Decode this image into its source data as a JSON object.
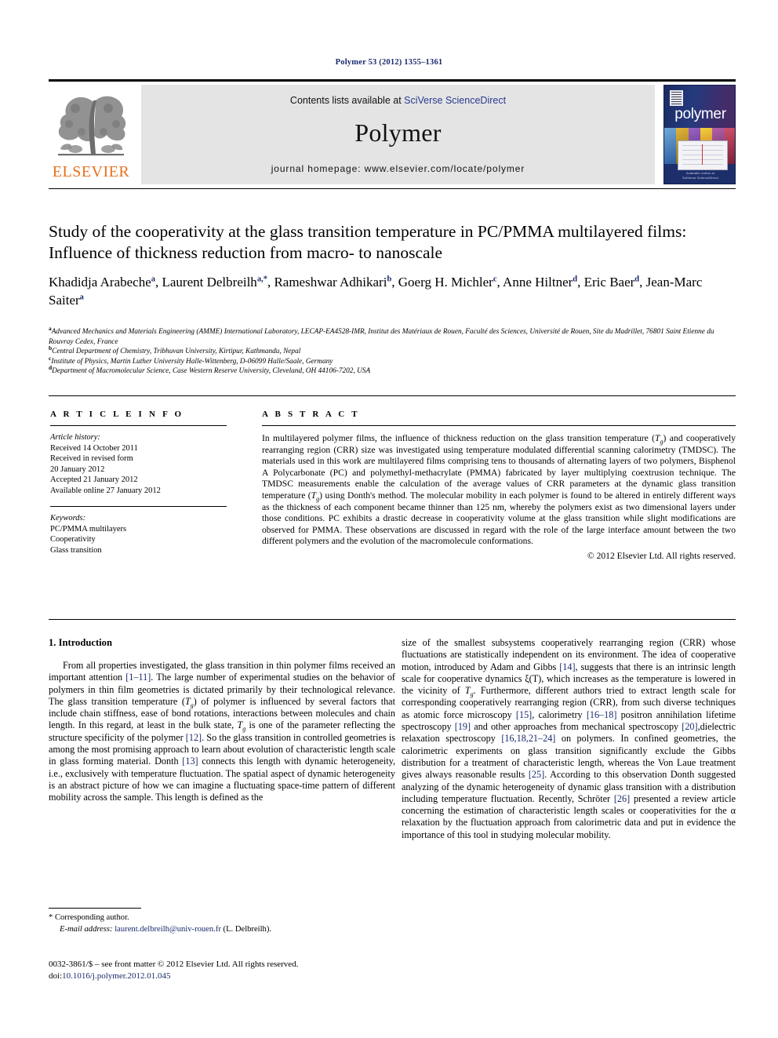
{
  "running_head": "Polymer 53 (2012) 1355–1361",
  "masthead": {
    "publisher_name": "ELSEVIER",
    "contents_prefix": "Contents lists available at ",
    "contents_link": "SciVerse ScienceDirect",
    "journal_title": "Polymer",
    "homepage": "journal homepage: www.elsevier.com/locate/polymer",
    "cover_word": "polymer",
    "cover_footer": "Available online at\nSciVerse ScienceDirect"
  },
  "article": {
    "title": "Study of the cooperativity at the glass transition temperature in PC/PMMA multilayered films: Influence of thickness reduction from macro- to nanoscale",
    "authors_line_1": "Khadidja Arabeche a, Laurent Delbreilh a,*, Rameshwar Adhikari b, Goerg H. Michler c, Anne Hiltner d,",
    "authors_line_2": "Eric Baer d, Jean-Marc Saiter a",
    "authors": [
      {
        "name": "Khadidja Arabeche",
        "sup": "a",
        "sep": ","
      },
      {
        "name": "Laurent Delbreilh",
        "sup": "a,*",
        "sep": ","
      },
      {
        "name": "Rameshwar Adhikari",
        "sup": "b",
        "sep": ","
      },
      {
        "name": "Goerg H. Michler",
        "sup": "c",
        "sep": ","
      },
      {
        "name": "Anne Hiltner",
        "sup": "d",
        "sep": ","
      },
      {
        "name": "Eric Baer",
        "sup": "d",
        "sep": ","
      },
      {
        "name": "Jean-Marc Saiter",
        "sup": "a",
        "sep": ""
      }
    ],
    "affiliations": [
      {
        "label": "a",
        "text": "Advanced Mechanics and Materials Engineering (AMME) International Laboratory, LECAP-EA4528-IMR, Institut des Matériaux de Rouen, Faculté des Sciences, Université de Rouen, Site du Madrillet, 76801 Saint Etienne du Rouvray Cedex, France"
      },
      {
        "label": "b",
        "text": "Central Department of Chemistry, Tribhuvan University, Kirtipur, Kathmandu, Nepal"
      },
      {
        "label": "c",
        "text": "Institute of Physics, Martin Luther University Halle-Wittenberg, D-06099 Halle/Saale, Germany"
      },
      {
        "label": "d",
        "text": "Department of Macromolecular Science, Case Western Reserve University, Cleveland, OH 44106-7202, USA"
      }
    ]
  },
  "article_info": {
    "heading": "A R T I C L E   I N F O",
    "history_label": "Article history:",
    "history": [
      "Received 14 October 2011",
      "Received in revised form",
      "20 January 2012",
      "Accepted 21 January 2012",
      "Available online 27 January 2012"
    ],
    "keywords_label": "Keywords:",
    "keywords": [
      "PC/PMMA multilayers",
      "Cooperativity",
      "Glass transition"
    ]
  },
  "abstract": {
    "heading": "A B S T R A C T",
    "text": "In multilayered polymer films, the influence of thickness reduction on the glass transition temperature (Tg) and cooperatively rearranging region (CRR) size was investigated using temperature modulated differential scanning calorimetry (TMDSC). The materials used in this work are multilayered films comprising tens to thousands of alternating layers of two polymers, Bisphenol A Polycarbonate (PC) and polymethyl-methacrylate (PMMA) fabricated by layer multiplying coextrusion technique. The TMDSC measurements enable the calculation of the average values of CRR parameters at the dynamic glass transition temperature (Tg) using Donth's method. The molecular mobility in each polymer is found to be altered in entirely different ways as the thickness of each component became thinner than 125 nm, whereby the polymers exist as two dimensional layers under those conditions. PC exhibits a drastic decrease in cooperativity volume at the glass transition while slight modifications are observed for PMMA. These observations are discussed in regard with the role of the large interface amount between the two different polymers and the evolution of the macromolecule conformations.",
    "copyright": "© 2012 Elsevier Ltd. All rights reserved."
  },
  "body": {
    "section_number_title": "1. Introduction",
    "left_paragraph": "From all properties investigated, the glass transition in thin polymer films received an important attention [1–11]. The large number of experimental studies on the behavior of polymers in thin film geometries is dictated primarily by their technological relevance. The glass transition temperature (Tg) of polymer is influenced by several factors that include chain stiffness, ease of bond rotations, interactions between molecules and chain length. In this regard, at least in the bulk state, Tg is one of the parameter reflecting the structure specificity of the polymer [12]. So the glass transition in controlled geometries is among the most promising approach to learn about evolution of characteristic length scale in glass forming material. Donth [13] connects this length with dynamic heterogeneity, i.e., exclusively with temperature fluctuation. The spatial aspect of dynamic heterogeneity is an abstract picture of how we can imagine a fluctuating space-time pattern of different mobility across the sample. This length is defined as the",
    "right_paragraph": "size of the smallest subsystems cooperatively rearranging region (CRR) whose fluctuations are statistically independent on its environment. The idea of cooperative motion, introduced by Adam and Gibbs [14], suggests that there is an intrinsic length scale for cooperative dynamics ξ(T), which increases as the temperature is lowered in the vicinity of Tg. Furthermore, different authors tried to extract length scale for corresponding cooperatively rearranging region (CRR), from such diverse techniques as atomic force microscopy [15], calorimetry [16–18] positron annihilation lifetime spectroscopy [19] and other approaches from mechanical spectroscopy [20],dielectric relaxation spectroscopy [16,18,21–24] on polymers. In confined geometries, the calorimetric experiments on glass transition significantly exclude the Gibbs distribution for a treatment of characteristic length, whereas the Von Laue treatment gives always reasonable results [25]. According to this observation Donth suggested analyzing of the dynamic heterogeneity of dynamic glass transition with a distribution including temperature fluctuation. Recently, Schröter [26] presented a review article concerning the estimation of characteristic length scales or cooperativities for the α relaxation by the fluctuation approach from calorimetric data and put in evidence the importance of this tool in studying molecular mobility."
  },
  "footer": {
    "corresponding_author": "* Corresponding author.",
    "email_label": "E-mail address:",
    "email": "laurent.delbreilh@univ-rouen.fr",
    "email_suffix": "(L. Delbreilh).",
    "imprint_line": "0032-3861/$ – see front matter © 2012 Elsevier Ltd. All rights reserved.",
    "doi_label": "doi:",
    "doi": "10.1016/j.polymer.2012.01.045"
  },
  "colors": {
    "link_blue": "#1a2a6c",
    "sciencedirect_blue": "#2b3a8f",
    "elsevier_orange": "#E9711C",
    "banner_gray": "#e4e4e4",
    "cover_navy": "#1d2f6b"
  }
}
